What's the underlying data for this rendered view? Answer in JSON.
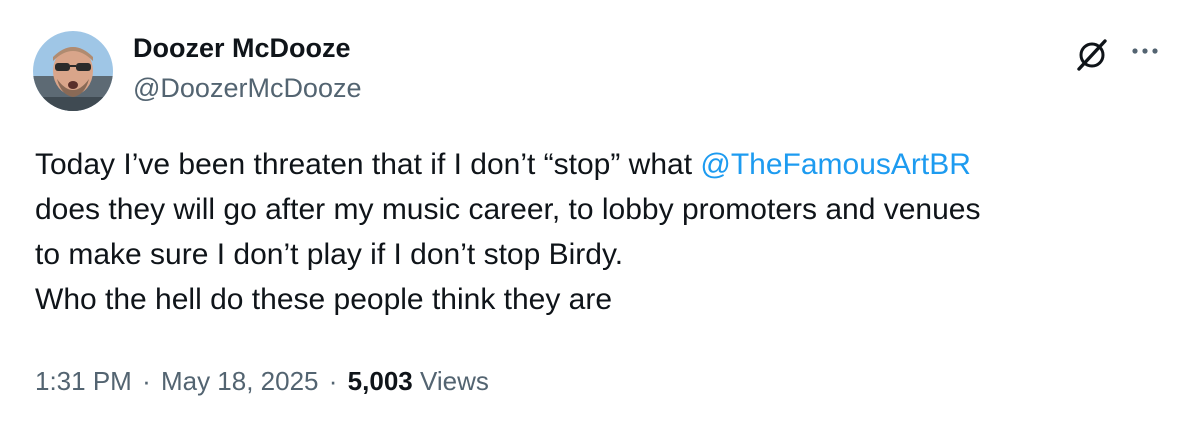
{
  "author": {
    "display_name": "Doozer McDooze",
    "handle": "@DoozerMcDooze"
  },
  "actions": {
    "grok_icon": "grok-icon",
    "more_icon": "more-icon"
  },
  "tweet": {
    "line1_before": "Today I’ve been threaten that if I don’t “stop” what ",
    "mention": "@TheFamousArtBR",
    "line2": "does they will go after my music career, to lobby promoters and venues",
    "line3": "to make sure I don’t play if I don’t stop Birdy.",
    "line4": "Who the hell do these people think they are"
  },
  "meta": {
    "time": "1:31 PM",
    "separator": "·",
    "date": "May 18, 2025",
    "views_count": "5,003",
    "views_label": "Views"
  },
  "colors": {
    "text": "#0f1419",
    "secondary": "#536471",
    "link": "#1d9bf0"
  }
}
